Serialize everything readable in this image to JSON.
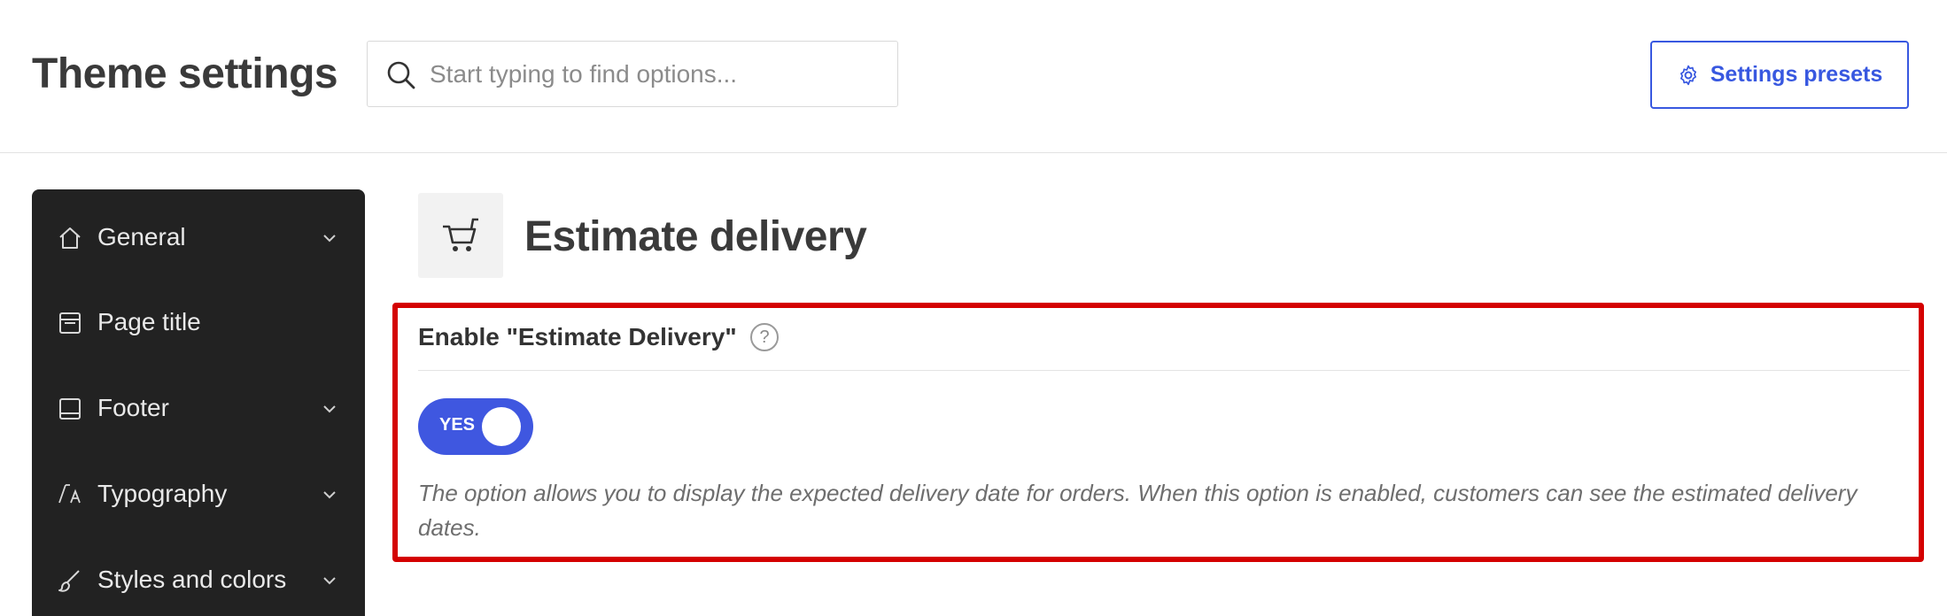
{
  "header": {
    "title": "Theme settings",
    "search_placeholder": "Start typing to find options...",
    "presets_label": "Settings presets",
    "search_icon": "search-icon",
    "presets_icon": "gear-icon"
  },
  "sidebar": {
    "items": [
      {
        "label": "General",
        "icon": "home-icon",
        "expandable": true
      },
      {
        "label": "Page title",
        "icon": "page-icon",
        "expandable": false
      },
      {
        "label": "Footer",
        "icon": "footer-icon",
        "expandable": true
      },
      {
        "label": "Typography",
        "icon": "typography-icon",
        "expandable": true
      },
      {
        "label": "Styles and colors",
        "icon": "brush-icon",
        "expandable": true
      }
    ]
  },
  "section": {
    "title": "Estimate delivery",
    "icon": "cart-icon"
  },
  "option": {
    "label": "Enable \"Estimate Delivery\"",
    "help": "?",
    "toggle_text": "YES",
    "toggle_on": true,
    "description": "The option allows you to display the expected delivery date for orders. When this option is enabled, customers can see the estimated delivery dates."
  },
  "colors": {
    "accent": "#3858e0",
    "sidebar_bg": "#222222",
    "highlight": "#d40000"
  }
}
